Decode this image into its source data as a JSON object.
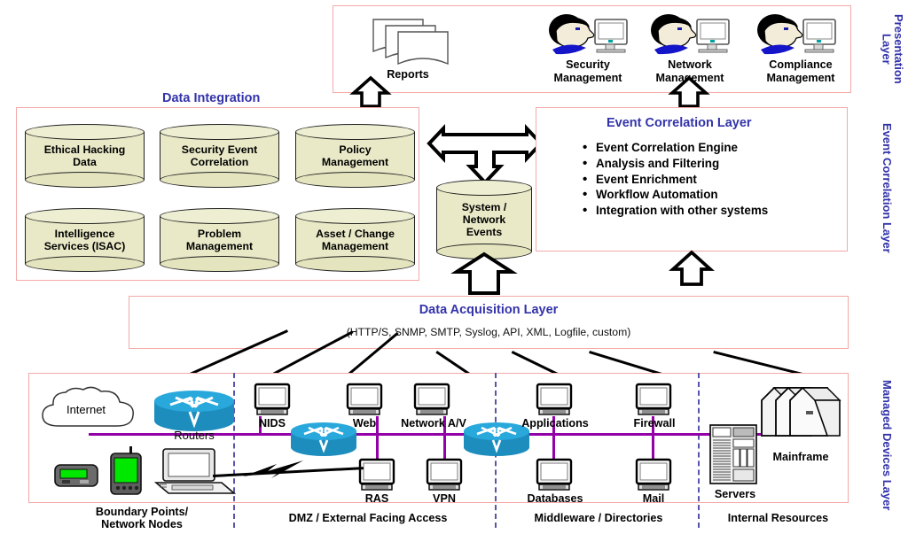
{
  "diagram": {
    "title": "Security Event Management Architecture",
    "accent_blue": "#3333aa",
    "box_border": "#f4a9a9",
    "cylinder_fill": "#e9e9c8",
    "network_line": "#9400a8",
    "zone_divider": "#5555aa",
    "router_color": "#29a8dc"
  },
  "vertical_labels": {
    "presentation": "Presentation\nLayer",
    "presentation_l1": "Presentation",
    "presentation_l2": "Layer",
    "event_correlation": "Event Correlation Layer",
    "managed_devices": "Managed Devices Layer"
  },
  "presentation_layer": {
    "items": [
      {
        "label": "Reports",
        "icon": "documents-icon"
      },
      {
        "label_l1": "Security",
        "label_l2": "Management",
        "icon": "user-monitor-icon"
      },
      {
        "label_l1": "Network",
        "label_l2": "Management",
        "icon": "user-monitor-icon"
      },
      {
        "label_l1": "Compliance",
        "label_l2": "Management",
        "icon": "user-monitor-icon"
      }
    ]
  },
  "data_integration": {
    "title": "Data Integration",
    "stores": [
      {
        "line1": "Ethical Hacking",
        "line2": "Data"
      },
      {
        "line1": "Security Event",
        "line2": "Correlation"
      },
      {
        "line1": "Policy",
        "line2": "Management"
      },
      {
        "line1": "Intelligence",
        "line2": "Services (ISAC)"
      },
      {
        "line1": "Problem",
        "line2": "Management"
      },
      {
        "line1": "Asset / Change",
        "line2": "Management"
      }
    ]
  },
  "events_store": {
    "line1": "System /",
    "line2": "Network",
    "line3": "Events"
  },
  "event_correlation_layer": {
    "title": "Event Correlation Layer",
    "bullets": [
      "Event Correlation Engine",
      "Analysis and Filtering",
      "Event Enrichment",
      "Workflow Automation",
      "Integration with other systems"
    ]
  },
  "data_acquisition_layer": {
    "title": "Data Acquisition Layer",
    "protocols": "(HTTP/S, SNMP, SMTP, Syslog, API, XML, Logfile, custom)"
  },
  "managed_devices": {
    "zones": [
      {
        "label_l1": "Boundary Points/",
        "label_l2": "Network Nodes"
      },
      {
        "label_l1": "DMZ / External Facing  Access",
        "label_l2": ""
      },
      {
        "label_l1": "Middleware / Directories",
        "label_l2": ""
      },
      {
        "label_l1": "Internal Resources",
        "label_l2": ""
      }
    ],
    "nodes": [
      {
        "label": "Internet",
        "icon": "cloud-icon"
      },
      {
        "label": "Routers",
        "icon": "router-icon"
      },
      {
        "label": "NIDS",
        "icon": "computer-icon"
      },
      {
        "label": "Web",
        "icon": "computer-icon"
      },
      {
        "label": "Network A/V",
        "icon": "computer-icon"
      },
      {
        "label": "RAS",
        "icon": "computer-icon"
      },
      {
        "label": "VPN",
        "icon": "computer-icon"
      },
      {
        "label": "Applications",
        "icon": "computer-icon"
      },
      {
        "label": "Firewall",
        "icon": "computer-icon"
      },
      {
        "label": "Databases",
        "icon": "computer-icon"
      },
      {
        "label": "Mail",
        "icon": "computer-icon"
      },
      {
        "label": "Servers",
        "icon": "server-rack-icon"
      },
      {
        "label": "Mainframe",
        "icon": "mainframe-icon"
      }
    ],
    "mobile_devices": [
      {
        "icon": "pager-icon"
      },
      {
        "icon": "pda-icon"
      },
      {
        "icon": "laptop-icon"
      }
    ]
  }
}
